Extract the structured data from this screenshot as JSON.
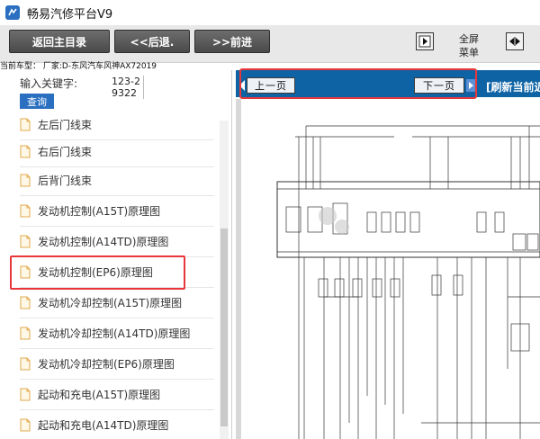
{
  "app": {
    "title": "畅易汽修平台V9"
  },
  "toolbar": {
    "home_label": "返回主目录",
    "back_label": "<<后退.",
    "forward_label": ">>前进",
    "fullscreen_label": "全屏",
    "menu_label": "菜单"
  },
  "car_model": "当前车型： 厂家:D-东风汽车风神AX72019",
  "search": {
    "label": "输入关键字:",
    "value": "123-29322",
    "button": "查询"
  },
  "list": {
    "items": [
      {
        "label": "左后门线束"
      },
      {
        "label": "右后门线束"
      },
      {
        "label": "后背门线束"
      },
      {
        "label": "发动机控制(A15T)原理图"
      },
      {
        "label": "发动机控制(A14TD)原理图"
      },
      {
        "label": "发动机控制(EP6)原理图"
      },
      {
        "label": "发动机冷却控制(A15T)原理图"
      },
      {
        "label": "发动机冷却控制(A14TD)原理图"
      },
      {
        "label": "发动机冷却控制(EP6)原理图"
      },
      {
        "label": "起动和充电(A15T)原理图"
      },
      {
        "label": "起动和充电(A14TD)原理图"
      }
    ],
    "selected_index": 5
  },
  "viewer": {
    "prev_label": "上一页",
    "next_label": "下一页",
    "refresh_label": "[刷新当前近"
  },
  "colors": {
    "accent_blue": "#0e63a5",
    "button_gray": "#5a5a5a",
    "highlight_red": "#e8373b"
  }
}
